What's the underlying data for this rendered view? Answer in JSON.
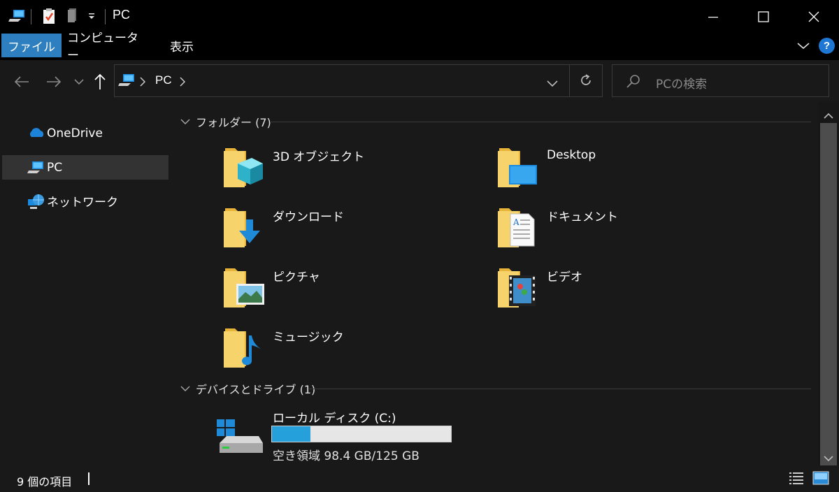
{
  "window": {
    "title": "PC"
  },
  "ribbon": {
    "tabs": [
      {
        "label": "ファイル",
        "active": true
      },
      {
        "label": "コンピューター",
        "active": false
      },
      {
        "label": "表示",
        "active": false
      }
    ],
    "help_label": "?"
  },
  "address": {
    "location": "PC"
  },
  "search": {
    "placeholder": "PCの検索"
  },
  "sidebar": {
    "items": [
      {
        "label": "OneDrive",
        "icon": "onedrive-icon",
        "selected": false
      },
      {
        "label": "PC",
        "icon": "pc-icon",
        "selected": true
      },
      {
        "label": "ネットワーク",
        "icon": "network-icon",
        "selected": false
      }
    ]
  },
  "content": {
    "folders_header": "フォルダー (7)",
    "folders": [
      {
        "label": "3D オブジェクト",
        "icon": "3d-objects-folder-icon"
      },
      {
        "label": "Desktop",
        "icon": "desktop-folder-icon"
      },
      {
        "label": "ダウンロード",
        "icon": "downloads-folder-icon"
      },
      {
        "label": "ドキュメント",
        "icon": "documents-folder-icon"
      },
      {
        "label": "ピクチャ",
        "icon": "pictures-folder-icon"
      },
      {
        "label": "ビデオ",
        "icon": "videos-folder-icon"
      },
      {
        "label": "ミュージック",
        "icon": "music-folder-icon"
      }
    ],
    "drives_header": "デバイスとドライブ (1)",
    "drive": {
      "name": "ローカル ディスク (C:)",
      "free_text": "空き領域 98.4 GB/125 GB",
      "used_fraction": 0.213
    }
  },
  "status": {
    "item_count": "9 個の項目"
  },
  "colors": {
    "accent": "#2d7fbf",
    "folder": "#f3c64b",
    "drive_bar": "#26a0da"
  }
}
